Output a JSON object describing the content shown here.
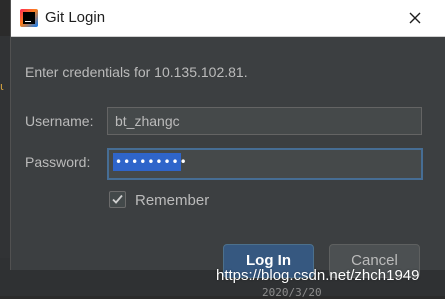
{
  "window": {
    "title": "Git Login",
    "icon": "intellij-idea-icon",
    "close_icon": "close-icon"
  },
  "dialog": {
    "message": "Enter credentials for 10.135.102.81.",
    "username_label": "Username:",
    "username_value": "bt_zhangc",
    "password_label": "Password:",
    "password_value_masked": "•••••••••",
    "remember_label": "Remember",
    "remember_checked": true,
    "login_button": "Log In",
    "cancel_button": "Cancel"
  },
  "background": {
    "bottom_text": "2020/3/20"
  },
  "watermark": "https://blog.csdn.net/zhch1949",
  "colors": {
    "dialog_bg": "#3c3f41",
    "field_bg": "#45494a",
    "focus_border": "#466d94",
    "selection": "#2f65ca",
    "primary_button": "#365880",
    "text": "#bbbbbb"
  }
}
